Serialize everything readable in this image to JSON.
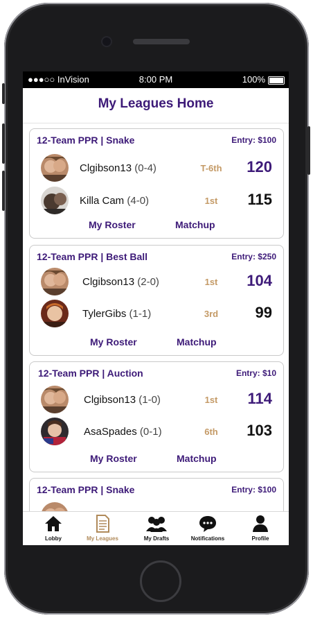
{
  "status_bar": {
    "carrier": "●●●○○ InVision",
    "time": "8:00 PM",
    "battery": "100%"
  },
  "header": {
    "title": "My Leagues Home"
  },
  "colors": {
    "purple": "#3d1a78",
    "rank": "#c49a66",
    "active_tab": "#b08a5a"
  },
  "leagues": [
    {
      "name": "12-Team PPR  |  Snake",
      "entry": "Entry: $100",
      "teams": [
        {
          "name": "Clgibson13",
          "record": "(0-4)",
          "rank": "T-6th",
          "score": "120",
          "score_color": "#3d1a78"
        },
        {
          "name": "Killa Cam",
          "record": "(4-0)",
          "rank": "1st",
          "score": "115",
          "score_color": "#111111"
        }
      ],
      "roster_label": "My Roster",
      "matchup_label": "Matchup"
    },
    {
      "name": "12-Team PPR  |  Best Ball",
      "entry": "Entry: $250",
      "teams": [
        {
          "name": "Clgibson13",
          "record": "(2-0)",
          "rank": "1st",
          "score": "104",
          "score_color": "#3d1a78"
        },
        {
          "name": "TylerGibs",
          "record": "(1-1)",
          "rank": "3rd",
          "score": "99",
          "score_color": "#111111"
        }
      ],
      "roster_label": "My Roster",
      "matchup_label": "Matchup"
    },
    {
      "name": "12-Team PPR  |  Auction",
      "entry": "Entry: $10",
      "teams": [
        {
          "name": "Clgibson13",
          "record": "(1-0)",
          "rank": "1st",
          "score": "114",
          "score_color": "#3d1a78"
        },
        {
          "name": "AsaSpades",
          "record": "(0-1)",
          "rank": "6th",
          "score": "103",
          "score_color": "#111111"
        }
      ],
      "roster_label": "My Roster",
      "matchup_label": "Matchup"
    },
    {
      "name": "12-Team PPR  |  Snake",
      "entry": "Entry: $100",
      "teams": [],
      "roster_label": "",
      "matchup_label": ""
    }
  ],
  "tabs": [
    {
      "label": "Lobby",
      "icon": "home-icon",
      "active": false
    },
    {
      "label": "My Leagues",
      "icon": "document-icon",
      "active": true
    },
    {
      "label": "My Drafts",
      "icon": "group-icon",
      "active": false
    },
    {
      "label": "Notifications",
      "icon": "chat-bubble-icon",
      "active": false
    },
    {
      "label": "Profile",
      "icon": "person-icon",
      "active": false
    }
  ]
}
